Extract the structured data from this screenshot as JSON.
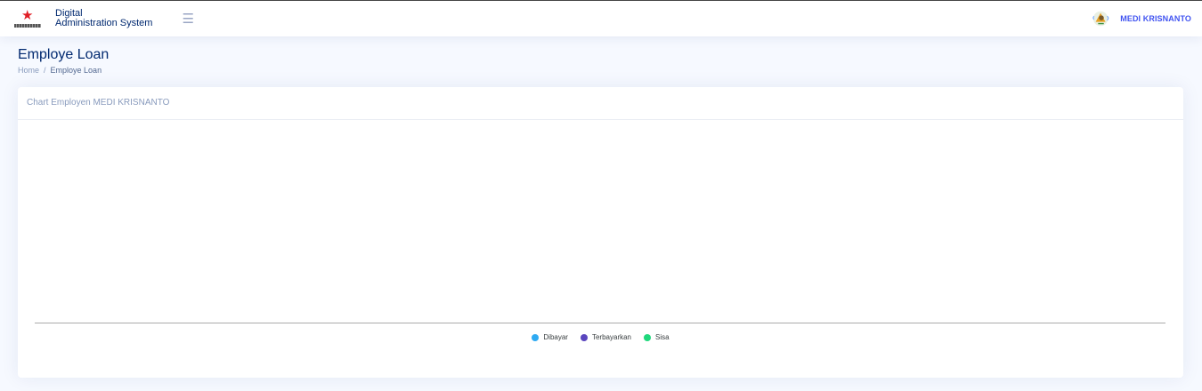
{
  "header": {
    "brand_line1": "Digital",
    "brand_line2": "Administration System",
    "menu_icon": "hamburger-icon",
    "user_name": "MEDI KRISNANTO",
    "accent_color": "#4154f1"
  },
  "page": {
    "title": "Employe Loan",
    "breadcrumb": [
      {
        "label": "Home"
      },
      {
        "label": "Employe Loan"
      }
    ]
  },
  "card": {
    "title": "Chart Employen MEDI KRISNANTO"
  },
  "chart_data": {
    "type": "bar",
    "title": "",
    "categories": [],
    "series": [
      {
        "name": "Dibayar",
        "color": "#2eaaf2",
        "values": []
      },
      {
        "name": "Terbayarkan",
        "color": "#5a46be",
        "values": []
      },
      {
        "name": "Sisa",
        "color": "#1fd87c",
        "values": []
      }
    ],
    "legend": "bottom-center",
    "grid": false
  }
}
